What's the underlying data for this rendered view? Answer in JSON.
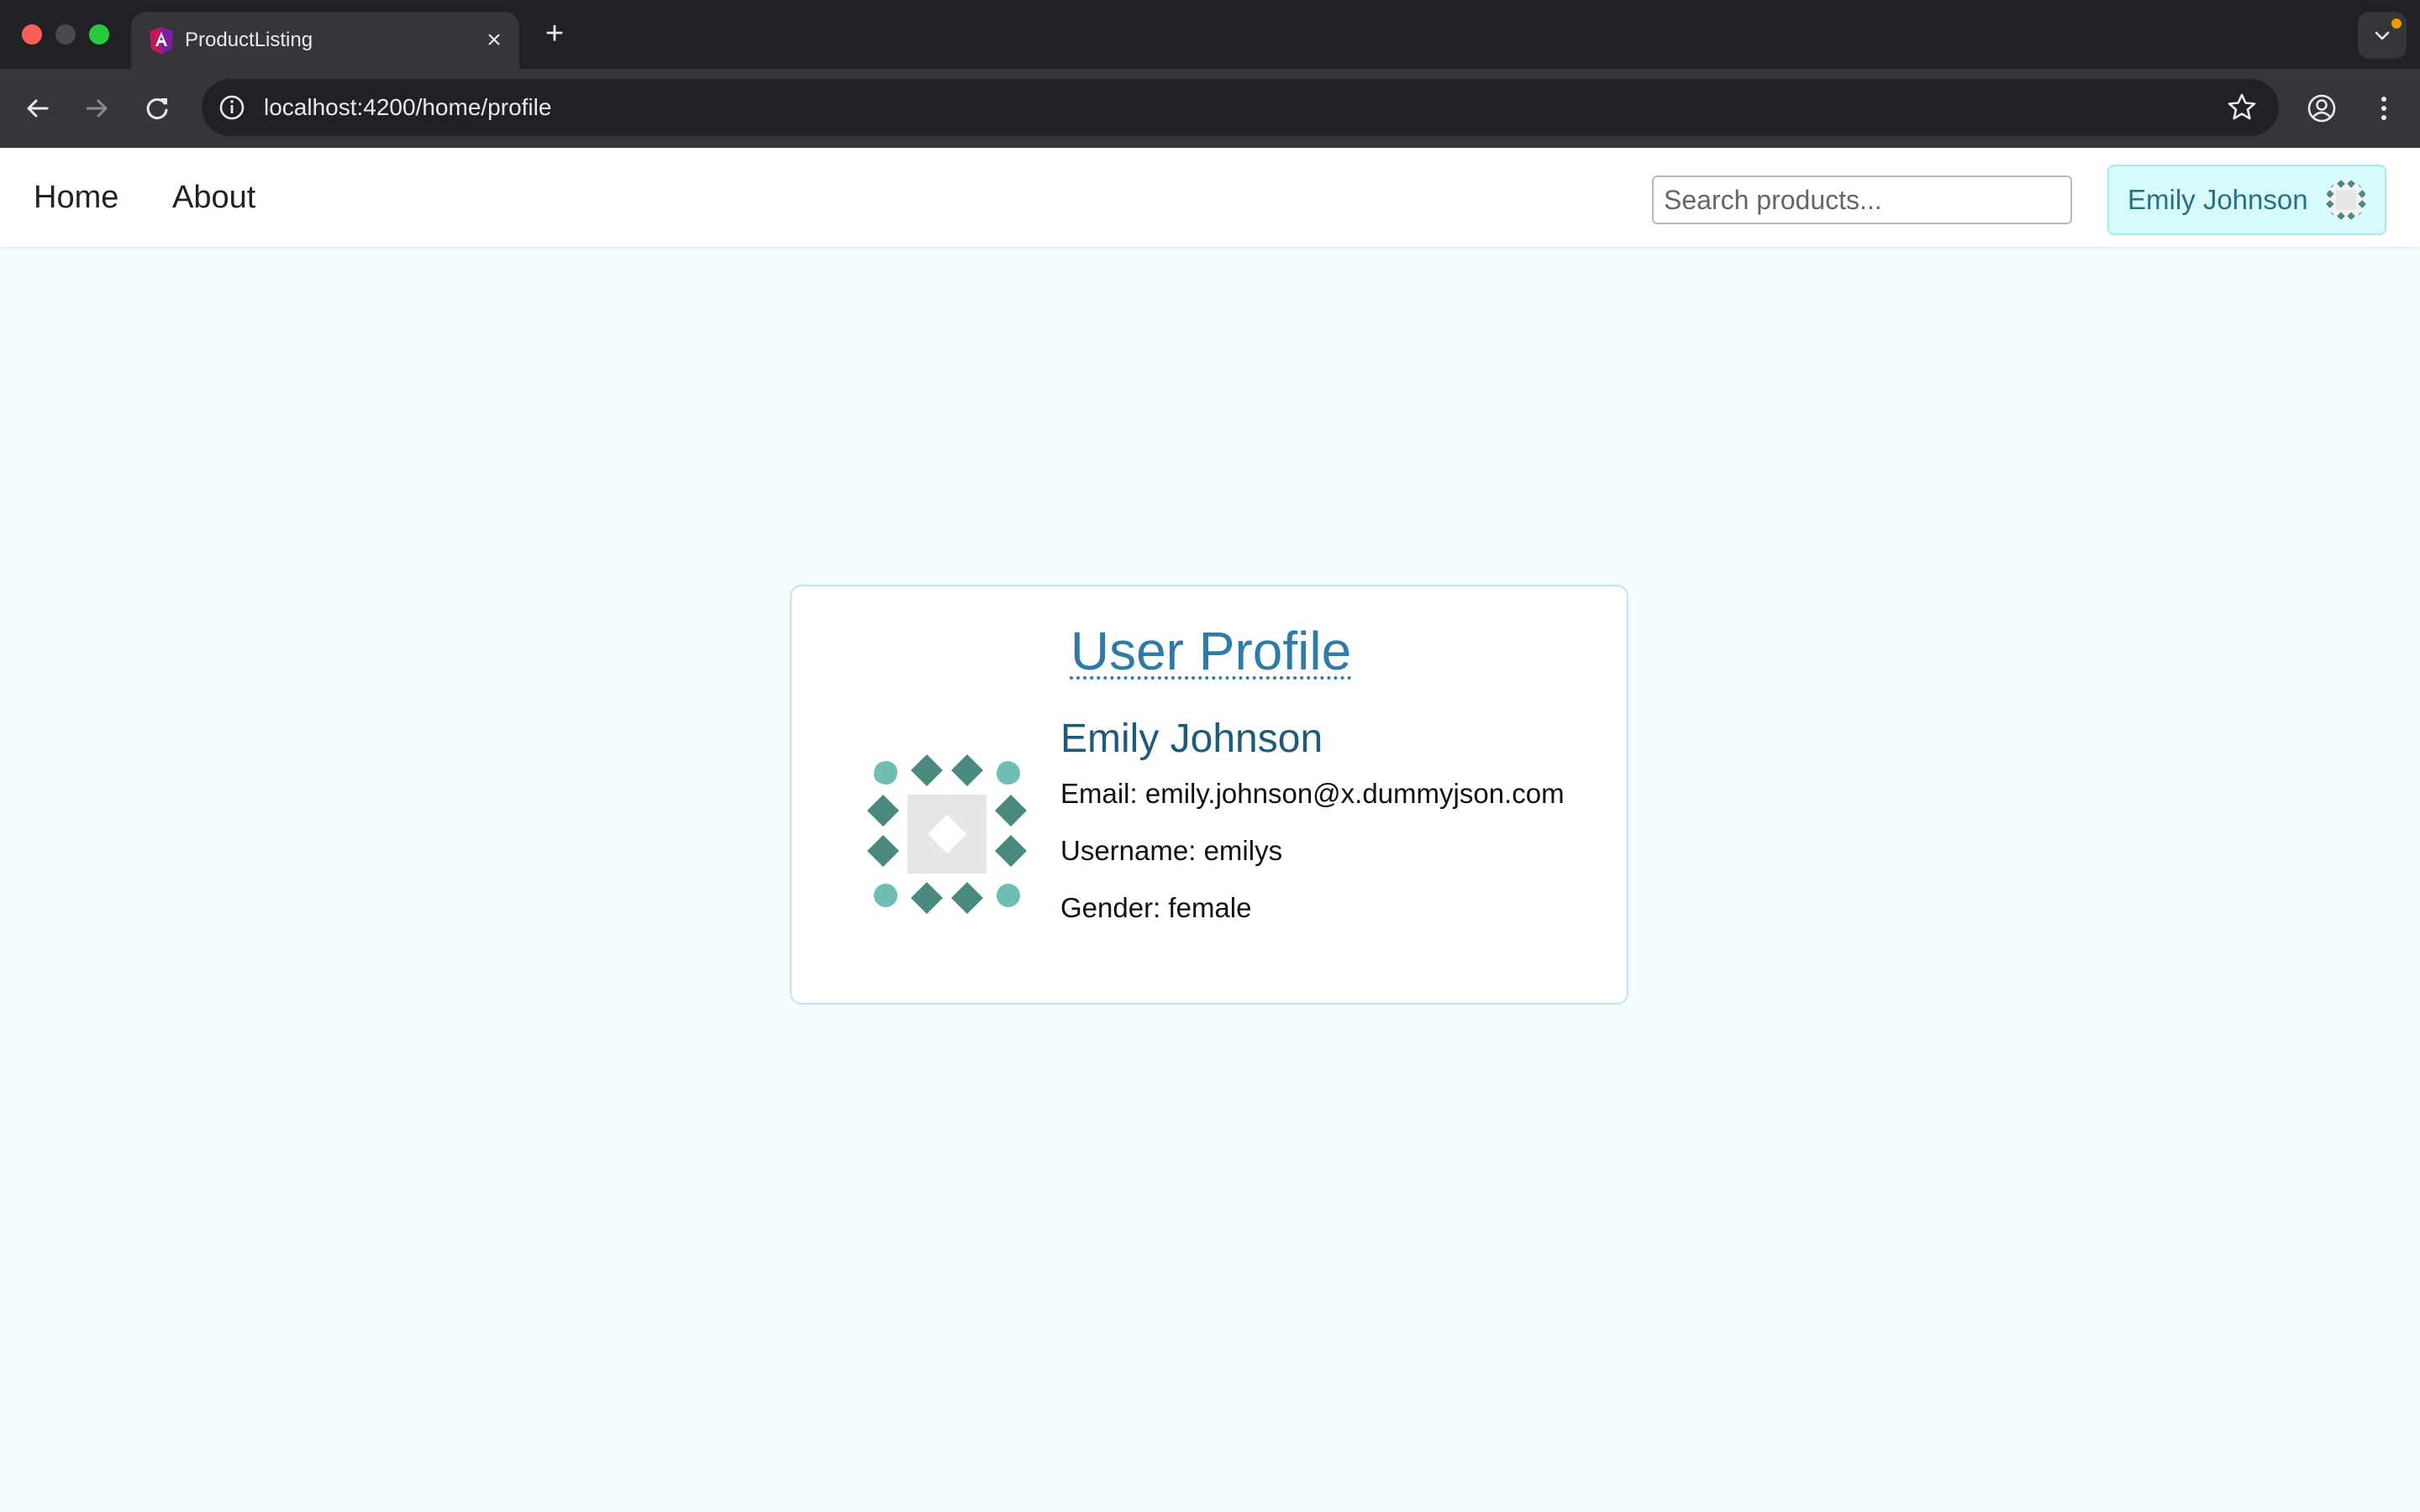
{
  "browser": {
    "tab_title": "ProductListing",
    "url": "localhost:4200/home/profile"
  },
  "navbar": {
    "links": [
      "Home",
      "About"
    ],
    "search_placeholder": "Search products...",
    "user_name": "Emily Johnson"
  },
  "profile": {
    "heading": "User Profile",
    "name": "Emily Johnson",
    "email_label": "Email:",
    "email": "emily.johnson@x.dummyjson.com",
    "username_label": "Username:",
    "username": "emilys",
    "gender_label": "Gender:",
    "gender": "female"
  },
  "colors": {
    "page_bg": "#f4fcfd",
    "accent": "#2c7ba8",
    "avatar_primary": "#4a8a7e",
    "avatar_secondary": "#6fbeb4"
  },
  "icons": [
    "angular-favicon-icon",
    "close-icon",
    "plus-icon",
    "chevron-down-icon",
    "back-arrow-icon",
    "forward-arrow-icon",
    "reload-icon",
    "info-icon",
    "star-icon",
    "profile-icon",
    "kebab-menu-icon",
    "identicon-avatar"
  ]
}
